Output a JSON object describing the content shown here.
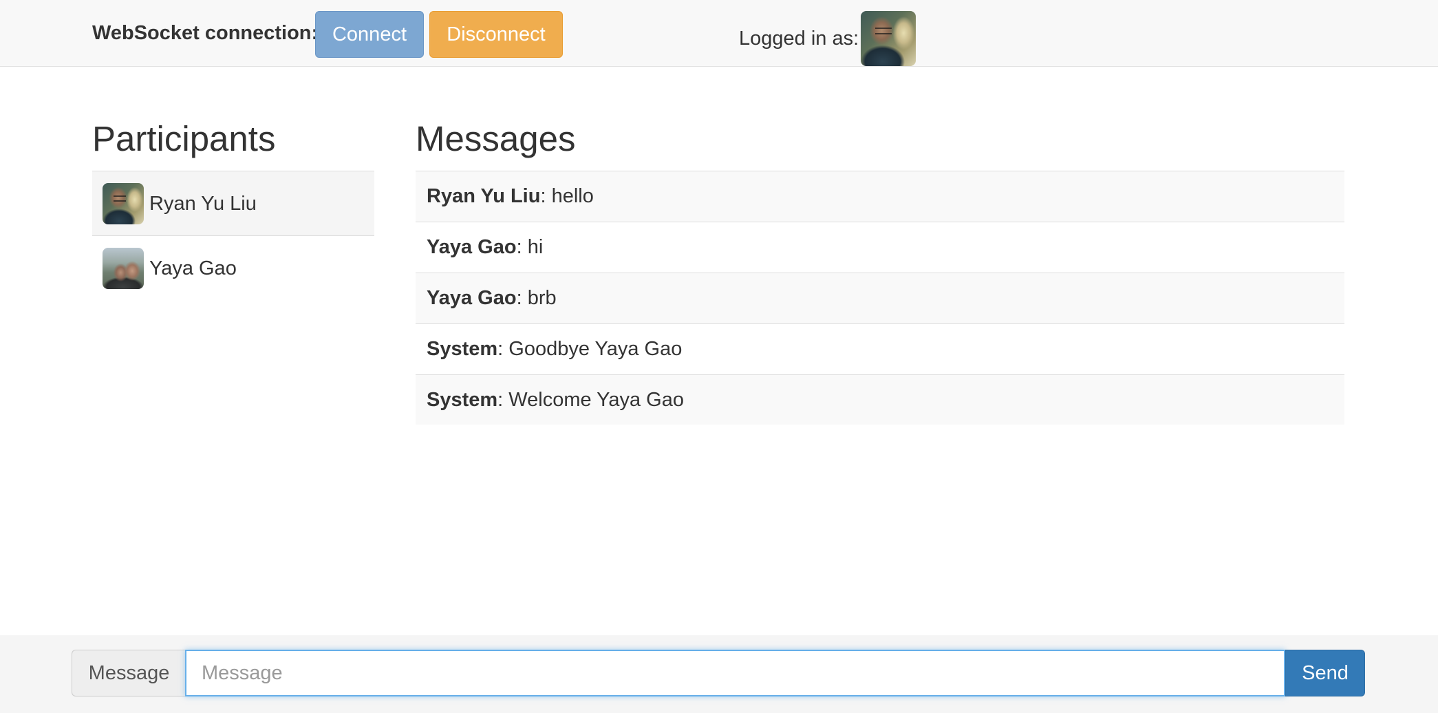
{
  "navbar": {
    "ws_label": "WebSocket connection:",
    "connect_label": "Connect",
    "disconnect_label": "Disconnect",
    "logged_in_label": "Logged in as:"
  },
  "participants": {
    "title": "Participants",
    "items": [
      {
        "name": "Ryan Yu Liu"
      },
      {
        "name": "Yaya Gao"
      }
    ]
  },
  "messages": {
    "title": "Messages",
    "items": [
      {
        "sender": "Ryan Yu Liu",
        "text": ": hello"
      },
      {
        "sender": "Yaya Gao",
        "text": ": hi"
      },
      {
        "sender": "Yaya Gao",
        "text": ": brb"
      },
      {
        "sender": "System",
        "text": ": Goodbye Yaya Gao"
      },
      {
        "sender": "System",
        "text": ": Welcome Yaya Gao"
      }
    ]
  },
  "composer": {
    "addon_label": "Message",
    "input_value": "",
    "input_placeholder": "Message",
    "send_label": "Send"
  },
  "colors": {
    "connect_button": "#7da7d2",
    "disconnect_button": "#f0ad4e",
    "send_button": "#337ab7",
    "input_focus_border": "#66afe9"
  }
}
